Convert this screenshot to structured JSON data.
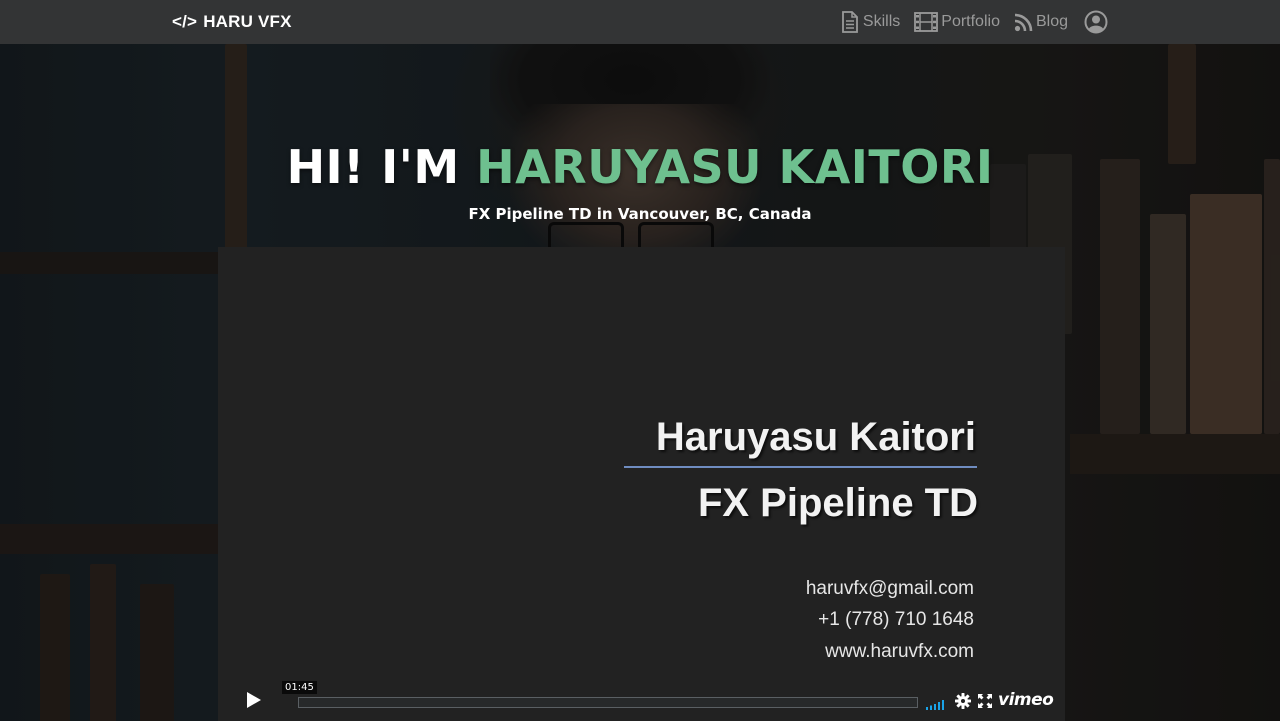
{
  "nav": {
    "brand": "HARU VFX",
    "brand_icon": "code-icon",
    "links": [
      {
        "label": "Skills",
        "icon": "document-icon"
      },
      {
        "label": "Portfolio",
        "icon": "film-icon"
      },
      {
        "label": "Blog",
        "icon": "rss-icon"
      }
    ],
    "user_icon": "user-circle-icon"
  },
  "hero": {
    "title_prefix": "HI! I'M",
    "title_name": "HARUYASU KAITORI",
    "subtitle": "FX Pipeline TD in Vancouver, BC, Canada",
    "accent_color": "#6ec08f"
  },
  "video": {
    "name": "Haruyasu Kaitori",
    "role": "FX Pipeline TD",
    "email": "haruvfx@gmail.com",
    "phone": "+1 (778) 710 1648",
    "website": "www.haruvfx.com",
    "duration": "01:45",
    "provider": "vimeo",
    "rule_color": "#6f8cc0"
  }
}
